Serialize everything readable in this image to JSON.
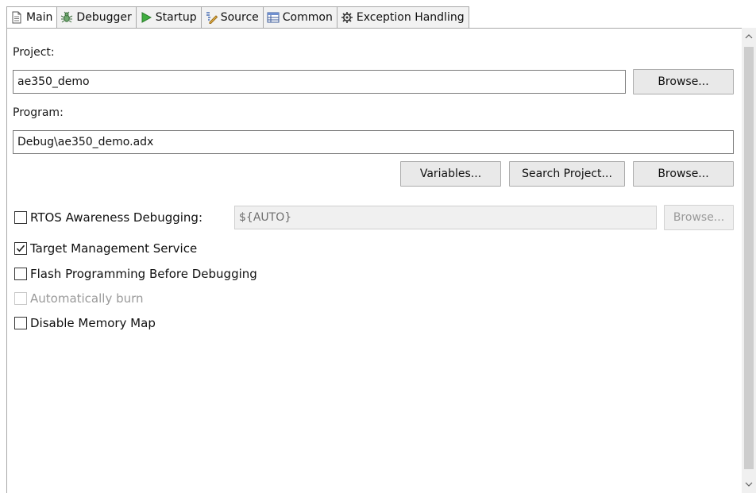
{
  "tabs": [
    {
      "label": "Main",
      "icon": "document-icon",
      "active": true
    },
    {
      "label": "Debugger",
      "icon": "bug-icon",
      "active": false
    },
    {
      "label": "Startup",
      "icon": "play-icon",
      "active": false
    },
    {
      "label": "Source",
      "icon": "source-icon",
      "active": false
    },
    {
      "label": "Common",
      "icon": "table-icon",
      "active": false
    },
    {
      "label": "Exception Handling",
      "icon": "gear-icon",
      "active": false
    }
  ],
  "project": {
    "label": "Project:",
    "value": "ae350_demo",
    "browse_label": "Browse..."
  },
  "program": {
    "label": "Program:",
    "value": "Debug\\ae350_demo.adx",
    "variables_label": "Variables...",
    "search_label": "Search Project...",
    "browse_label": "Browse..."
  },
  "rtos": {
    "label": "RTOS Awareness Debugging:",
    "checked": false,
    "value": "${AUTO}",
    "browse_label": "Browse..."
  },
  "options": [
    {
      "label": "Target Management Service",
      "checked": true,
      "enabled": true
    },
    {
      "label": "Flash Programming Before Debugging",
      "checked": false,
      "enabled": true
    },
    {
      "label": "Automatically burn",
      "checked": false,
      "enabled": false
    },
    {
      "label": "Disable Memory Map",
      "checked": false,
      "enabled": true
    }
  ],
  "colors": {
    "tab_border": "#a9a9a9",
    "play_green": "#3fae3f",
    "bug_green": "#4e8f4e"
  }
}
